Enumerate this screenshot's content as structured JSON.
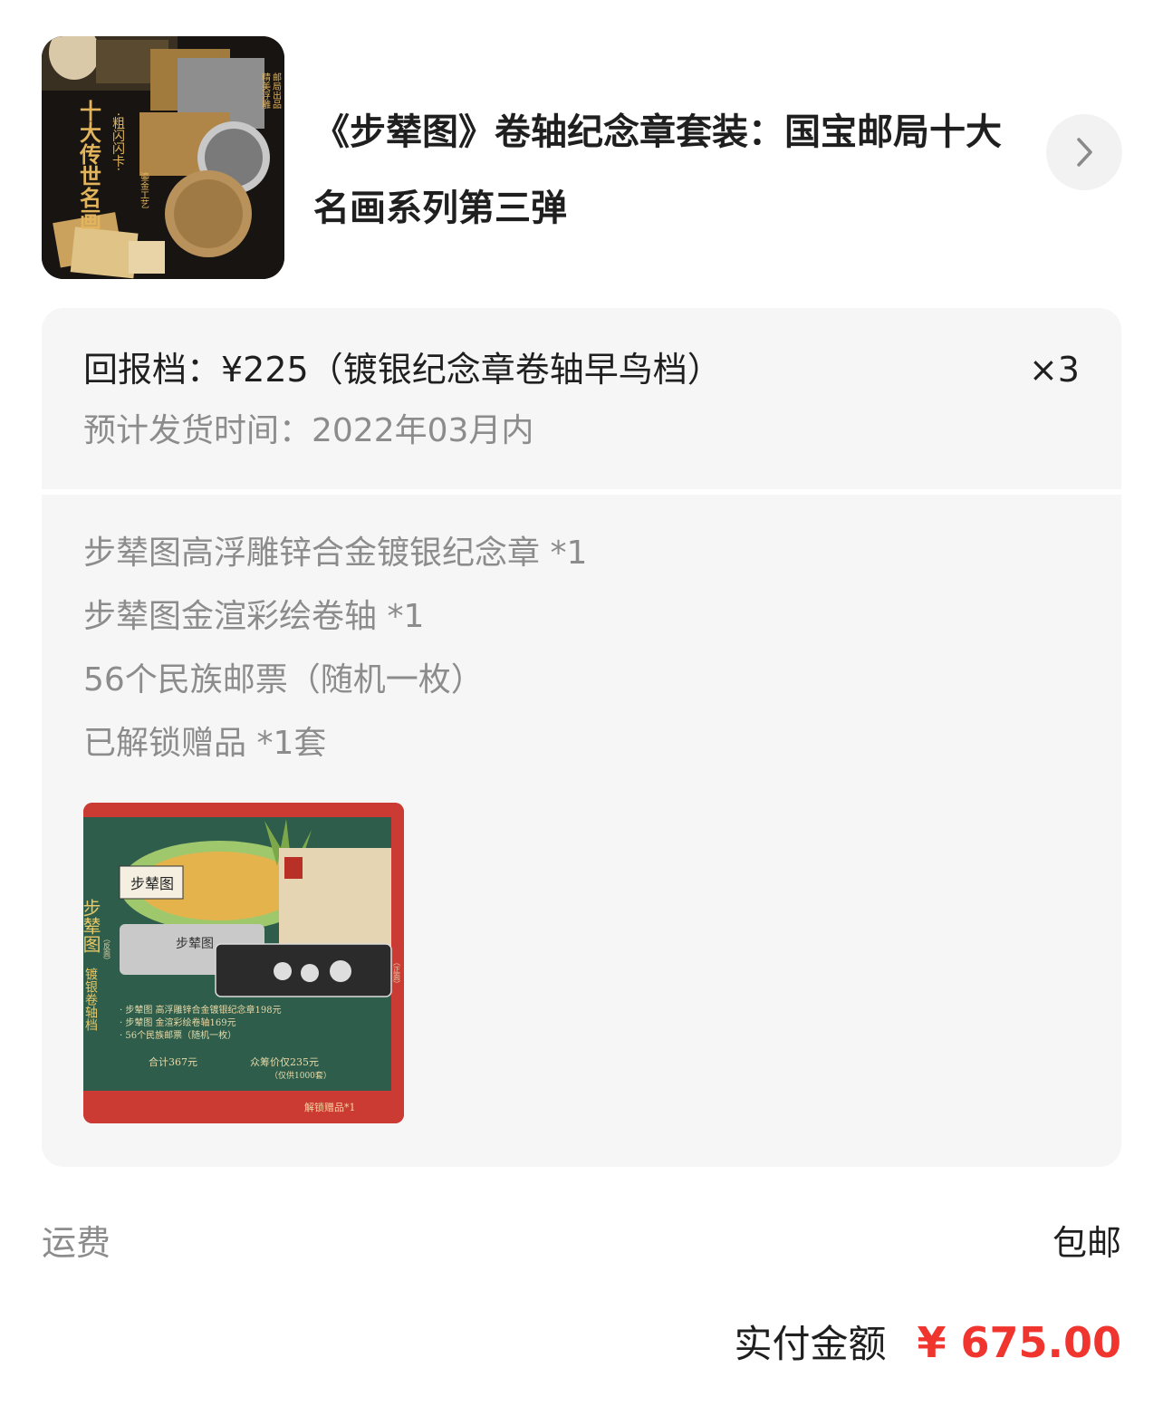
{
  "product": {
    "title": "《步辇图》卷轴纪念章套装：国宝邮局十大名画系列第三弹",
    "thumbnail_text": {
      "main": "十大传世名画",
      "sub": "·粗闪闪卡·",
      "side1": "鎏金工艺",
      "side2": "精美浮雕",
      "side3": "邮局出品"
    }
  },
  "reward": {
    "tier_title": "回报档：¥225（镀银纪念章卷轴早鸟档）",
    "quantity": "×3",
    "ship_time": "预计发货时间：2022年03月内",
    "items": [
      "步辇图高浮雕锌合金镀银纪念章 *1",
      "步辇图金渲彩绘卷轴 *1",
      "56个民族邮票（随机一枚）",
      "已解锁赠品 *1套"
    ],
    "gift_image_text": {
      "vertical_title": "步辇图",
      "vertical_sub": "镀银卷轴档",
      "scroll_label": "步辇图",
      "medal_label": "步辇图",
      "reverse": "（反面）",
      "front": "（正面）",
      "list": [
        "· 步辇图 高浮雕锌合金镀银纪念章198元",
        "· 步辇图 金渲彩绘卷轴169元",
        "· 56个民族邮票（随机一枚）"
      ],
      "total_original": "合计367元",
      "crowd_price": "众筹价仅235元",
      "limited": "（仅供1000套）",
      "unlock": "解锁赠品*1"
    }
  },
  "shipping": {
    "label": "运费",
    "value": "包邮"
  },
  "total": {
    "label": "实付金额",
    "amount": "¥ 675.00"
  },
  "colors": {
    "price_red": "#f0352f",
    "card_bg": "#f6f6f6",
    "muted_text": "#8c8c8c"
  }
}
